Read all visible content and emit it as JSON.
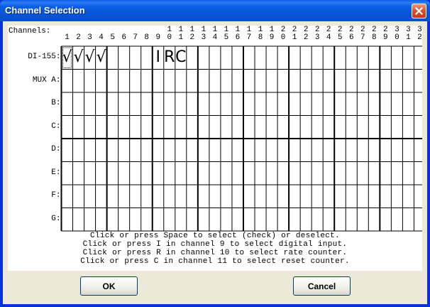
{
  "window": {
    "title": "Channel Selection"
  },
  "grid": {
    "header_label": "Channels:",
    "channel_numbers": [
      "1",
      "2",
      "3",
      "4",
      "5",
      "6",
      "7",
      "8",
      "9",
      "10",
      "11",
      "12",
      "13",
      "14",
      "15",
      "16",
      "17",
      "18",
      "19",
      "20",
      "21",
      "22",
      "23",
      "24",
      "25",
      "26",
      "27",
      "28",
      "29",
      "30",
      "31",
      "32"
    ],
    "rows": [
      "DI-155:",
      "MUX A:",
      "B:",
      "C:",
      "D:",
      "E:",
      "F:",
      "G:"
    ],
    "marks": [
      {
        "row": 0,
        "col": 0,
        "mark": "√"
      },
      {
        "row": 0,
        "col": 1,
        "mark": "√"
      },
      {
        "row": 0,
        "col": 2,
        "mark": "√"
      },
      {
        "row": 0,
        "col": 3,
        "mark": "√"
      },
      {
        "row": 0,
        "col": 8,
        "mark": "I"
      },
      {
        "row": 0,
        "col": 9,
        "mark": "R"
      },
      {
        "row": 0,
        "col": 10,
        "mark": "C"
      }
    ]
  },
  "instructions": [
    "Click or press Space to select (check) or deselect.",
    "Click or press I in channel 9 to select digital input.",
    "Click or press R in channel 10 to select rate counter.",
    "Click or press C in channel 11 to select reset counter."
  ],
  "buttons": {
    "ok": "OK",
    "cancel": "Cancel"
  }
}
